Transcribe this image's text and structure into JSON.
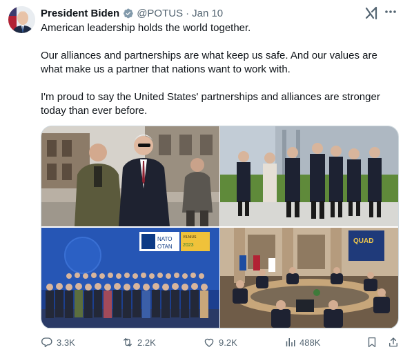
{
  "author": {
    "name": "President Biden",
    "handle": "@POTUS",
    "separator": "·",
    "date": "Jan 10",
    "verified": true
  },
  "header_icons": {
    "grok": "grok-icon",
    "more": "more-icon"
  },
  "tweet": {
    "paragraphs": [
      "American leadership holds the world together.",
      "Our alliances and partnerships are what keep us safe. And our values are what make us a partner that nations want to work with.",
      "I'm proud to say the United States' partnerships and alliances are stronger today than ever before."
    ]
  },
  "media": {
    "nato_sign": {
      "line1": "NATO",
      "line2": "OTAN",
      "side": "VILNIUS",
      "year": "2023"
    },
    "quad_sign": "QUAD"
  },
  "actions": {
    "replies": "3.3K",
    "reposts": "2.2K",
    "likes": "9.2K",
    "views": "488K"
  },
  "colors": {
    "text": "#0f1419",
    "muted": "#536471",
    "verified_badge": "#829aab",
    "border": "#cfd9de"
  }
}
